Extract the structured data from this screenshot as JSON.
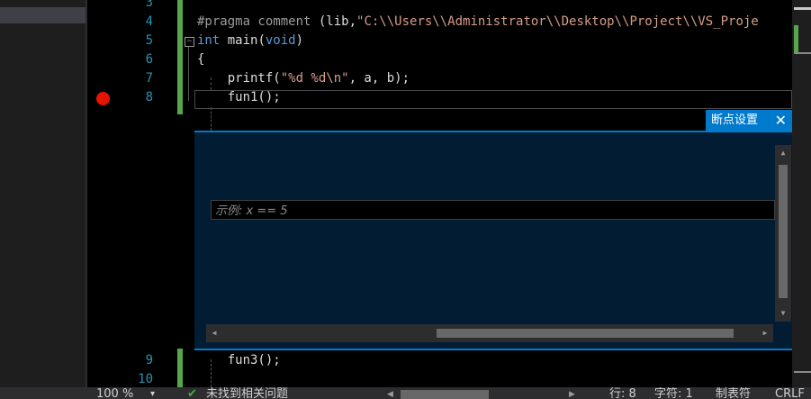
{
  "editor": {
    "line_numbers": [
      "3",
      "4",
      "5",
      "6",
      "7",
      "8",
      "9",
      "10"
    ],
    "code": {
      "pragma_kw": "#pragma comment",
      "pragma_args_pre": " (lib,",
      "pragma_str": "\"C:\\\\Users\\\\Administrator\\\\Desktop\\\\Project\\\\VS_Proje",
      "main_int": "int",
      "main_rest": " main(",
      "main_void": "void",
      "main_close": ")",
      "open_brace": "{",
      "printf_pre": "    printf(",
      "printf_str": "\"%d %d\\n\"",
      "printf_post": ", a, b);",
      "fun1": "    fun1();",
      "fun3": "    fun3();"
    },
    "collapse_glyph": "−"
  },
  "breakpoint_settings": {
    "title": "断点设置",
    "close_glyph": "✕",
    "condition_placeholder": "示例: x == 5"
  },
  "scrollbars": {
    "up": "▲",
    "down": "▼",
    "left": "◀",
    "right": "▶"
  },
  "status_bar": {
    "zoom": "100 %",
    "zoom_arrow": "▾",
    "ok_icon": "✔",
    "issues": "未找到相关问题",
    "scroll_left": "◀",
    "scroll_right": "▶",
    "line": "行: 8",
    "char": "字符: 1",
    "tabs": "制表符",
    "eol": "CRLF"
  },
  "colors": {
    "accent": "#007acc",
    "breakpoint": "#e51400",
    "change_bar": "#57a64a",
    "peek_bg": "#021d33"
  }
}
